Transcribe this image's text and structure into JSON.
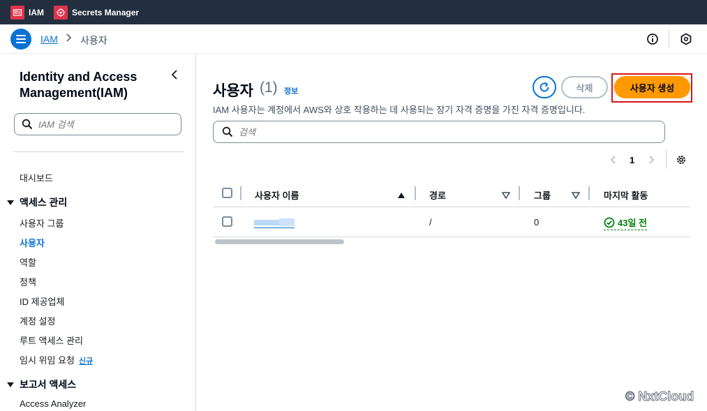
{
  "topbar": {
    "services": [
      {
        "label": "IAM",
        "icon": "iam-service-icon"
      },
      {
        "label": "Secrets Manager",
        "icon": "secrets-manager-service-icon"
      }
    ]
  },
  "breadcrumb": {
    "root": "IAM",
    "current": "사용자"
  },
  "sidebar": {
    "title": "Identity and Access Management(IAM)",
    "search_placeholder": "IAM 검색",
    "dashboard": "대시보드",
    "section_access": "액세스 관리",
    "items_access": [
      "사용자 그룹",
      "사용자",
      "역할",
      "정책",
      "ID 제공업체",
      "계정 설정",
      "루트 액세스 관리",
      "임시 위임 요청"
    ],
    "new_badge": "신규",
    "section_reports": "보고서 액세스",
    "items_reports": [
      "Access Analyzer"
    ]
  },
  "main": {
    "title": "사용자",
    "count": "(1)",
    "info_link": "정보",
    "description": "IAM 사용자는 계정에서 AWS와 상호 작용하는 데 사용되는 장기 자격 증명을 가진 자격 증명입니다.",
    "delete_label": "삭제",
    "create_label": "사용자 생성",
    "search_placeholder": "검색",
    "page_number": "1"
  },
  "table": {
    "columns": [
      "사용자 이름",
      "경로",
      "그룹",
      "마지막 활동"
    ],
    "rows": [
      {
        "path": "/",
        "groups": "0",
        "last_activity": "43일 전"
      }
    ]
  },
  "watermark": "© NxtCloud",
  "colors": {
    "accent": "#0972d3",
    "primary_button": "#ff9900",
    "topbar": "#232f3e",
    "success": "#037f0c",
    "highlight": "#d91515"
  }
}
